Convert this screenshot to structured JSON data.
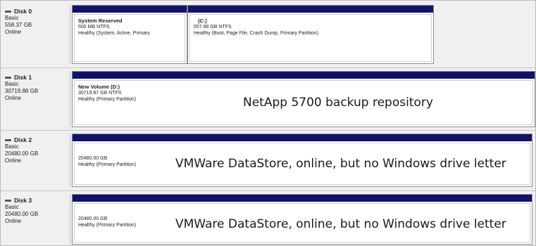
{
  "disks": [
    {
      "name": "Disk 0",
      "type": "Basic",
      "size": "558.37 GB",
      "status": "Online",
      "volumes": [
        {
          "name": "System Reserved",
          "fs": "500 MB NTFS",
          "health": "Healthy (System, Active, Primary"
        },
        {
          "name": "(C:)",
          "fs": "557.88 GB NTFS",
          "health": "Healthy (Boot, Page File, Crash Dump, Primary Partition)"
        }
      ]
    },
    {
      "name": "Disk 1",
      "type": "Basic",
      "size": "30719.88 GB",
      "status": "Online",
      "volumes": [
        {
          "name": "New Volume  (D:)",
          "fs": "30719.87 GB NTFS",
          "health": "Healthy (Primary Partition)"
        }
      ],
      "annotation": "NetApp 5700 backup repository"
    },
    {
      "name": "Disk 2",
      "type": "Basic",
      "size": "20480.00 GB",
      "status": "Online",
      "volumes": [
        {
          "fs": "20480.00 GB",
          "health": "Healthy (Primary Partition)"
        }
      ],
      "annotation": "VMWare DataStore, online, but no Windows drive letter"
    },
    {
      "name": "Disk 3",
      "type": "Basic",
      "size": "20480.00 GB",
      "status": "Online",
      "volumes": [
        {
          "fs": "20480.00 GB",
          "health": "Healthy (Primary Partition)"
        }
      ],
      "annotation": "VMWare DataStore, online, but no Windows drive letter"
    }
  ],
  "colors": {
    "volume_bar": "#12126b",
    "background": "#f0f0f0"
  }
}
